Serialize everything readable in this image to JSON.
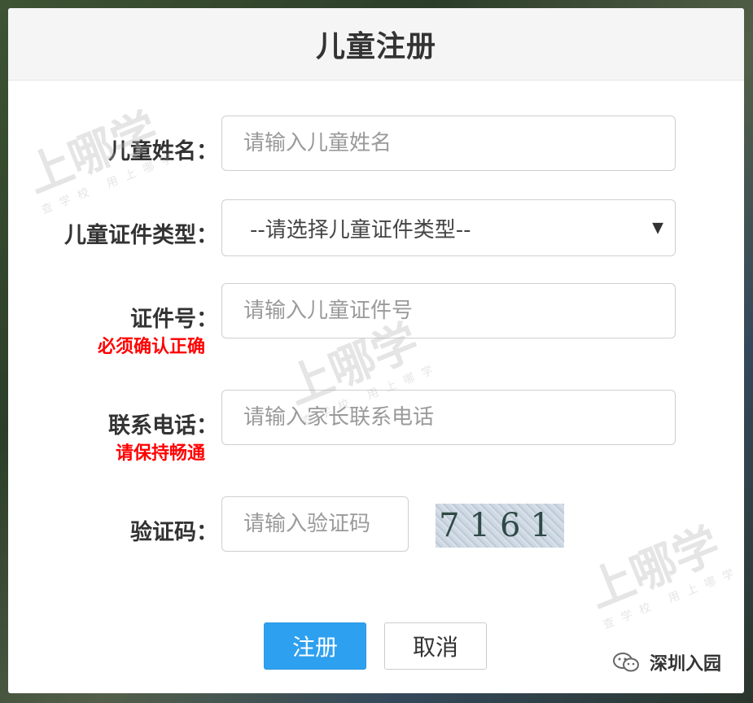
{
  "modal": {
    "title": "儿童注册"
  },
  "form": {
    "child_name": {
      "label": "儿童姓名：",
      "placeholder": "请输入儿童姓名"
    },
    "id_type": {
      "label": "儿童证件类型：",
      "selected": "--请选择儿童证件类型--"
    },
    "id_number": {
      "label": "证件号：",
      "hint": "必须确认正确",
      "placeholder": "请输入儿童证件号"
    },
    "phone": {
      "label": "联系电话：",
      "hint": "请保持畅通",
      "placeholder": "请输入家长联系电话"
    },
    "captcha": {
      "label": "验证码：",
      "placeholder": "请输入验证码",
      "code": "7161"
    }
  },
  "buttons": {
    "submit": "注册",
    "cancel": "取消"
  },
  "watermark": {
    "main": "上哪学",
    "sub": "查学校 用上哪学"
  },
  "footer": {
    "brand": "深圳入园"
  },
  "icons": {
    "select_arrow": "chevron-down-icon",
    "footer": "wechat-icon"
  },
  "colors": {
    "primary": "#2ea0f0",
    "hint": "#ff0000",
    "header_bg": "#f5f5f5"
  }
}
